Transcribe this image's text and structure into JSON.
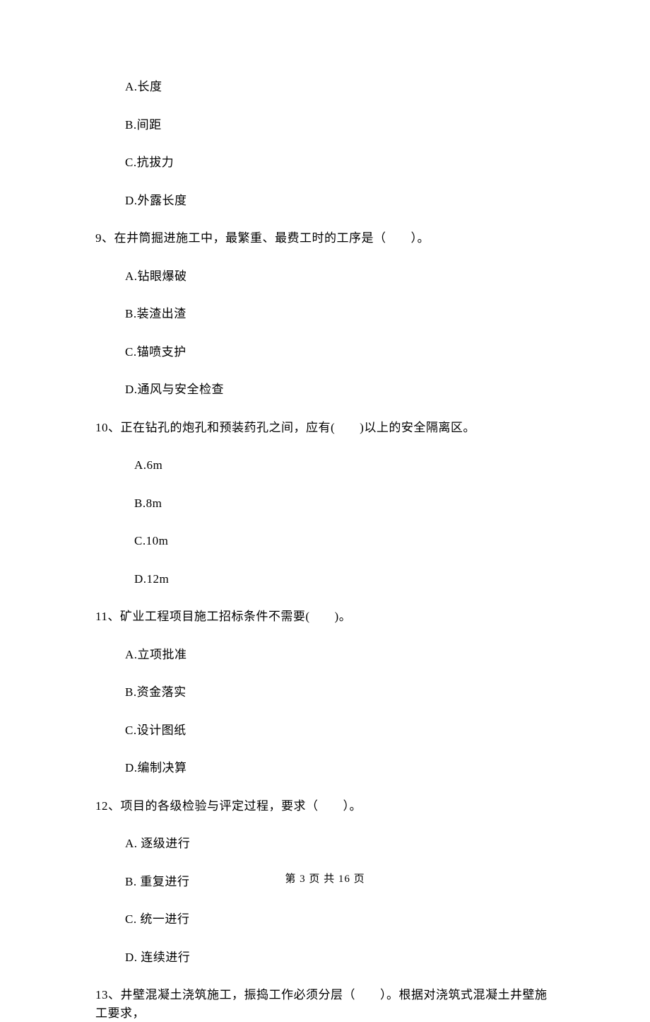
{
  "prev_options": {
    "a": "A.长度",
    "b": "B.间距",
    "c": "C.抗拔力",
    "d": "D.外露长度"
  },
  "q9": {
    "text": "9、在井筒掘进施工中，最繁重、最费工时的工序是（　　）。",
    "a": "A.钻眼爆破",
    "b": "B.装渣出渣",
    "c": "C.锚喷支护",
    "d": "D.通风与安全检查"
  },
  "q10": {
    "text": "10、正在钻孔的炮孔和预装药孔之间，应有(　　)以上的安全隔离区。",
    "a": "A.6m",
    "b": "B.8m",
    "c": "C.10m",
    "d": "D.12m"
  },
  "q11": {
    "text": "11、矿业工程项目施工招标条件不需要(　　)。",
    "a": "A.立项批准",
    "b": "B.资金落实",
    "c": "C.设计图纸",
    "d": "D.编制决算"
  },
  "q12": {
    "text": "12、项目的各级检验与评定过程，要求（　　）。",
    "a": "A. 逐级进行",
    "b": "B. 重复进行",
    "c": "C. 统一进行",
    "d": "D. 连续进行"
  },
  "q13": {
    "text": "13、井壁混凝土浇筑施工，振捣工作必须分层（　　）。根据对浇筑式混凝土井壁施工要求，"
  },
  "footer": "第 3 页 共 16 页"
}
